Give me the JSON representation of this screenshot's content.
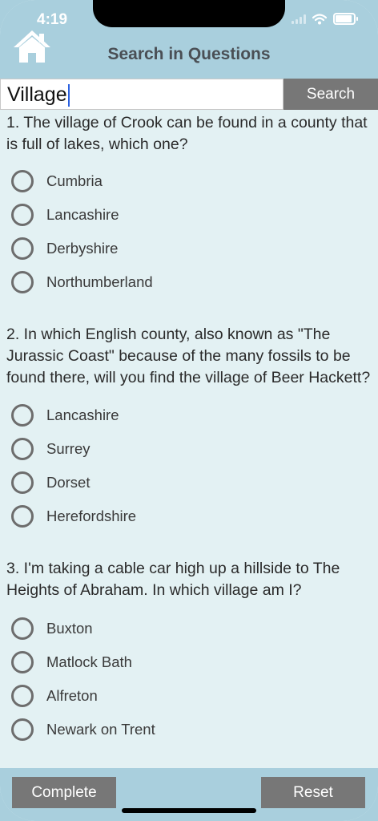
{
  "status": {
    "time": "4:19"
  },
  "header": {
    "title": "Search in Questions",
    "home_icon": "home-icon"
  },
  "search": {
    "value": "Village",
    "button_label": "Search"
  },
  "questions": [
    {
      "text": "1. The village of Crook can be found in a county that is full of lakes, which one?",
      "options": [
        "Cumbria",
        "Lancashire",
        "Derbyshire",
        "Northumberland"
      ]
    },
    {
      "text": "2. In which English county, also known as \"The Jurassic Coast\" because of the many fossils to be found there, will you find the village of Beer Hackett?",
      "options": [
        "Lancashire",
        "Surrey",
        "Dorset",
        "Herefordshire"
      ]
    },
    {
      "text": "3. I'm taking a cable car high up a hillside to The Heights of Abraham. In which village am I?",
      "options": [
        "Buxton",
        "Matlock Bath",
        "Alfreton",
        "Newark on Trent"
      ]
    }
  ],
  "footer": {
    "complete_label": "Complete",
    "reset_label": "Reset"
  },
  "colors": {
    "header_bg": "#a9cfdd",
    "content_bg": "#e3f1f3",
    "button_bg": "#777777"
  }
}
